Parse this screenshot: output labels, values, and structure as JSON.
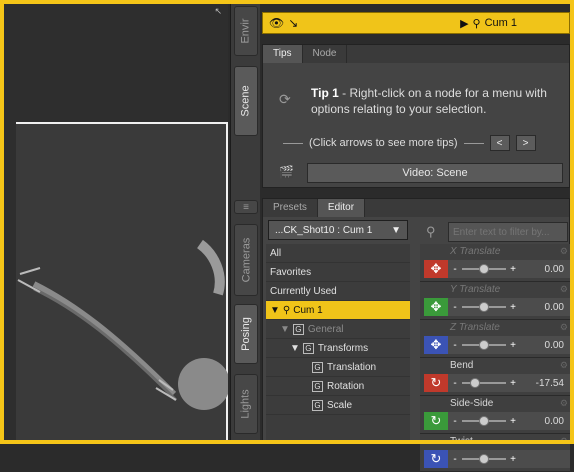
{
  "viewport": {
    "corner_glyph": "↖"
  },
  "side_tabs": [
    {
      "label": "Envir",
      "active": false
    },
    {
      "label": "Scene",
      "active": true
    },
    {
      "label": "Cameras",
      "active": false
    },
    {
      "label": "Posing",
      "active": true
    },
    {
      "label": "Lights",
      "active": false
    }
  ],
  "top_bar": {
    "node_label": "Cum 1"
  },
  "tips_pane": {
    "tabs": [
      "Tips",
      "Node"
    ],
    "tip_title": "Tip 1",
    "tip_body": " - Right-click on a node for a menu with options relating to your selection.",
    "nav_text": "(Click arrows to see more tips)",
    "prev": "<",
    "next": ">",
    "video_button": "Video: Scene"
  },
  "editor_pane": {
    "tabs": [
      "Presets",
      "Editor"
    ],
    "node_select": "...CK_Shot10 : Cum 1",
    "filter_placeholder": "Enter text to filter by...",
    "tree": [
      {
        "label": "All"
      },
      {
        "label": "Favorites"
      },
      {
        "label": "Currently Used"
      },
      {
        "label": "Cum 1"
      },
      {
        "label": "General"
      },
      {
        "label": "Transforms"
      },
      {
        "label": "Translation"
      },
      {
        "label": "Rotation"
      },
      {
        "label": "Scale"
      }
    ],
    "properties": [
      {
        "name": "X Translate",
        "value": "0.00",
        "color": "#c0392b",
        "level": 0.5
      },
      {
        "name": "Y Translate",
        "value": "0.00",
        "color": "#3a9a3a",
        "level": 0.5
      },
      {
        "name": "Z Translate",
        "value": "0.00",
        "color": "#3b53b5",
        "level": 0.5
      },
      {
        "name": "Bend",
        "value": "-17.54",
        "color": "#c0392b",
        "level": 0.3
      },
      {
        "name": "Side-Side",
        "value": "0.00",
        "color": "#3a9a3a",
        "level": 0.5
      },
      {
        "name": "Twist",
        "value": "",
        "color": "#3b53b5",
        "level": 0.5
      }
    ]
  }
}
